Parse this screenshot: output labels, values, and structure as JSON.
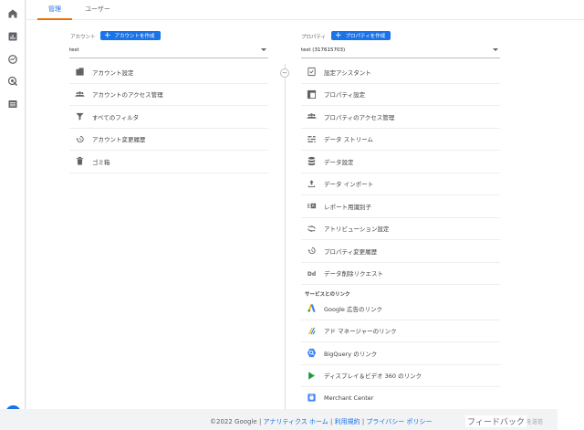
{
  "tabs": [
    {
      "label": "管理",
      "active": true
    },
    {
      "label": "ユーザー",
      "active": false
    }
  ],
  "nav_icons": [
    "home-icon",
    "reports-icon",
    "explore-icon",
    "advertising-icon",
    "configure-icon"
  ],
  "account": {
    "label": "アカウント",
    "create_button": "アカウントを作成",
    "selected": "test",
    "items": [
      {
        "icon": "building-icon",
        "label": "アカウント設定"
      },
      {
        "icon": "people-icon",
        "label": "アカウントのアクセス管理"
      },
      {
        "icon": "filter-icon",
        "label": "すべてのフィルタ"
      },
      {
        "icon": "history-icon",
        "label": "アカウント変更履歴"
      },
      {
        "icon": "trash-icon",
        "label": "ゴミ箱"
      }
    ]
  },
  "property": {
    "label": "プロパティ",
    "create_button": "プロパティを作成",
    "selected": "test (317615703)",
    "items": [
      {
        "icon": "checklist-icon",
        "label": "設定アシスタント"
      },
      {
        "icon": "property-settings-icon",
        "label": "プロパティ設定"
      },
      {
        "icon": "people-icon",
        "label": "プロパティのアクセス管理"
      },
      {
        "icon": "data-streams-icon",
        "label": "データ ストリーム"
      },
      {
        "icon": "database-icon",
        "label": "データ設定"
      },
      {
        "icon": "upload-icon",
        "label": "データ インポート"
      },
      {
        "icon": "report-id-icon",
        "label": "レポート用識別子"
      },
      {
        "icon": "attribution-icon",
        "label": "アトリビューション設定"
      },
      {
        "icon": "history-icon",
        "label": "プロパティ変更履歴"
      },
      {
        "icon": "data-deletion-icon",
        "label": "データ削除リクエスト"
      }
    ],
    "links_heading": "サービスとのリンク",
    "links": [
      {
        "icon": "google-ads-icon",
        "label": "Google 広告のリンク"
      },
      {
        "icon": "ad-manager-icon",
        "label": "アド マネージャーのリンク"
      },
      {
        "icon": "bigquery-icon",
        "label": "BigQuery のリンク"
      },
      {
        "icon": "display-video-icon",
        "label": "ディスプレイ＆ビデオ 360 のリンク"
      },
      {
        "icon": "merchant-center-icon",
        "label": "Merchant Center"
      }
    ]
  },
  "footer": {
    "copyright": "©2022 Google",
    "sep": " | ",
    "links": [
      "アナリティクス ホーム",
      "利用規約",
      "プライバシー ポリシー"
    ],
    "feedback": "フィードバック",
    "feedback_sub": "を送信"
  },
  "colors": {
    "accent": "#1a73e8",
    "tab_underline": "#e8710a"
  }
}
